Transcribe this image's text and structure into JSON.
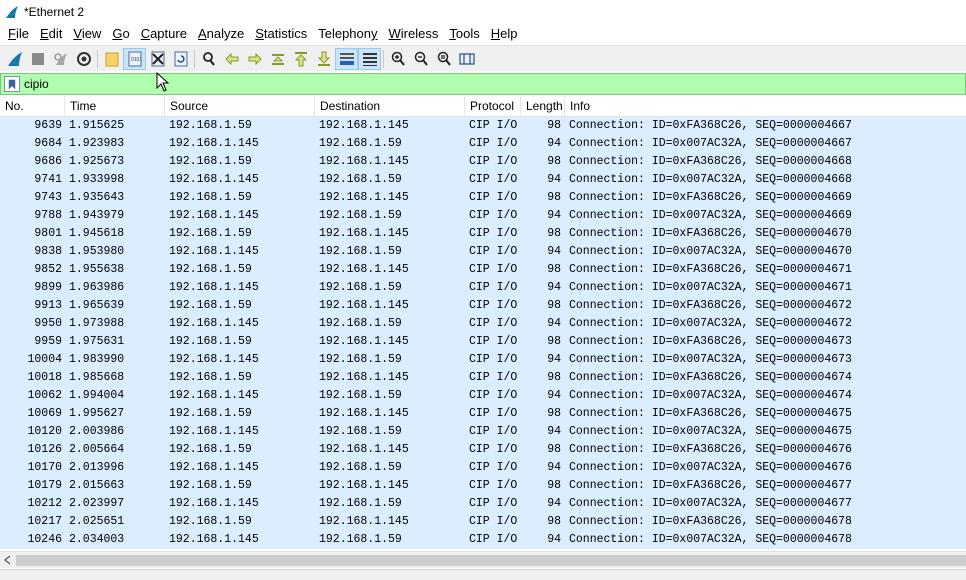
{
  "window": {
    "title": "*Ethernet 2"
  },
  "menu": [
    "File",
    "Edit",
    "View",
    "Go",
    "Capture",
    "Analyze",
    "Statistics",
    "Telephony",
    "Wireless",
    "Tools",
    "Help"
  ],
  "menu_underline": [
    "F",
    "E",
    "V",
    "G",
    "C",
    "A",
    "S",
    "y",
    "W",
    "T",
    "H"
  ],
  "toolbar": {
    "icons": [
      "shark-fin-start-icon",
      "stop-icon",
      "restart-icon",
      "options-gear-icon",
      "open-folder-icon",
      "save-file-icon",
      "close-file-icon",
      "reload-icon",
      "find-icon",
      "go-back-icon",
      "go-forward-icon",
      "go-to-packet-icon",
      "first-packet-icon",
      "last-packet-icon",
      "autoscroll-icon",
      "colorize-icon",
      "zoom-in-icon",
      "zoom-out-icon",
      "zoom-normal-icon",
      "resize-columns-icon"
    ]
  },
  "filter": {
    "value": "cipio",
    "bg_color": "#afffaf"
  },
  "columns": [
    "No.",
    "Time",
    "Source",
    "Destination",
    "Protocol",
    "Length",
    "Info"
  ],
  "rows": [
    [
      "9639",
      "1.915625",
      "192.168.1.59",
      "192.168.1.145",
      "CIP I/O",
      "98",
      "Connection: ID=0xFA368C26, SEQ=0000004667"
    ],
    [
      "9684",
      "1.923983",
      "192.168.1.145",
      "192.168.1.59",
      "CIP I/O",
      "94",
      "Connection: ID=0x007AC32A, SEQ=0000004667"
    ],
    [
      "9686",
      "1.925673",
      "192.168.1.59",
      "192.168.1.145",
      "CIP I/O",
      "98",
      "Connection: ID=0xFA368C26, SEQ=0000004668"
    ],
    [
      "9741",
      "1.933998",
      "192.168.1.145",
      "192.168.1.59",
      "CIP I/O",
      "94",
      "Connection: ID=0x007AC32A, SEQ=0000004668"
    ],
    [
      "9743",
      "1.935643",
      "192.168.1.59",
      "192.168.1.145",
      "CIP I/O",
      "98",
      "Connection: ID=0xFA368C26, SEQ=0000004669"
    ],
    [
      "9788",
      "1.943979",
      "192.168.1.145",
      "192.168.1.59",
      "CIP I/O",
      "94",
      "Connection: ID=0x007AC32A, SEQ=0000004669"
    ],
    [
      "9801",
      "1.945618",
      "192.168.1.59",
      "192.168.1.145",
      "CIP I/O",
      "98",
      "Connection: ID=0xFA368C26, SEQ=0000004670"
    ],
    [
      "9838",
      "1.953980",
      "192.168.1.145",
      "192.168.1.59",
      "CIP I/O",
      "94",
      "Connection: ID=0x007AC32A, SEQ=0000004670"
    ],
    [
      "9852",
      "1.955638",
      "192.168.1.59",
      "192.168.1.145",
      "CIP I/O",
      "98",
      "Connection: ID=0xFA368C26, SEQ=0000004671"
    ],
    [
      "9899",
      "1.963986",
      "192.168.1.145",
      "192.168.1.59",
      "CIP I/O",
      "94",
      "Connection: ID=0x007AC32A, SEQ=0000004671"
    ],
    [
      "9913",
      "1.965639",
      "192.168.1.59",
      "192.168.1.145",
      "CIP I/O",
      "98",
      "Connection: ID=0xFA368C26, SEQ=0000004672"
    ],
    [
      "9950",
      "1.973988",
      "192.168.1.145",
      "192.168.1.59",
      "CIP I/O",
      "94",
      "Connection: ID=0x007AC32A, SEQ=0000004672"
    ],
    [
      "9959",
      "1.975631",
      "192.168.1.59",
      "192.168.1.145",
      "CIP I/O",
      "98",
      "Connection: ID=0xFA368C26, SEQ=0000004673"
    ],
    [
      "10004",
      "1.983990",
      "192.168.1.145",
      "192.168.1.59",
      "CIP I/O",
      "94",
      "Connection: ID=0x007AC32A, SEQ=0000004673"
    ],
    [
      "10018",
      "1.985668",
      "192.168.1.59",
      "192.168.1.145",
      "CIP I/O",
      "98",
      "Connection: ID=0xFA368C26, SEQ=0000004674"
    ],
    [
      "10062",
      "1.994004",
      "192.168.1.145",
      "192.168.1.59",
      "CIP I/O",
      "94",
      "Connection: ID=0x007AC32A, SEQ=0000004674"
    ],
    [
      "10069",
      "1.995627",
      "192.168.1.59",
      "192.168.1.145",
      "CIP I/O",
      "98",
      "Connection: ID=0xFA368C26, SEQ=0000004675"
    ],
    [
      "10120",
      "2.003986",
      "192.168.1.145",
      "192.168.1.59",
      "CIP I/O",
      "94",
      "Connection: ID=0x007AC32A, SEQ=0000004675"
    ],
    [
      "10126",
      "2.005664",
      "192.168.1.59",
      "192.168.1.145",
      "CIP I/O",
      "98",
      "Connection: ID=0xFA368C26, SEQ=0000004676"
    ],
    [
      "10170",
      "2.013996",
      "192.168.1.145",
      "192.168.1.59",
      "CIP I/O",
      "94",
      "Connection: ID=0x007AC32A, SEQ=0000004676"
    ],
    [
      "10179",
      "2.015663",
      "192.168.1.59",
      "192.168.1.145",
      "CIP I/O",
      "98",
      "Connection: ID=0xFA368C26, SEQ=0000004677"
    ],
    [
      "10212",
      "2.023997",
      "192.168.1.145",
      "192.168.1.59",
      "CIP I/O",
      "94",
      "Connection: ID=0x007AC32A, SEQ=0000004677"
    ],
    [
      "10217",
      "2.025651",
      "192.168.1.59",
      "192.168.1.145",
      "CIP I/O",
      "98",
      "Connection: ID=0xFA368C26, SEQ=0000004678"
    ],
    [
      "10246",
      "2.034003",
      "192.168.1.145",
      "192.168.1.59",
      "CIP I/O",
      "94",
      "Connection: ID=0x007AC32A, SEQ=0000004678"
    ]
  ],
  "row_color": "#daeeff"
}
